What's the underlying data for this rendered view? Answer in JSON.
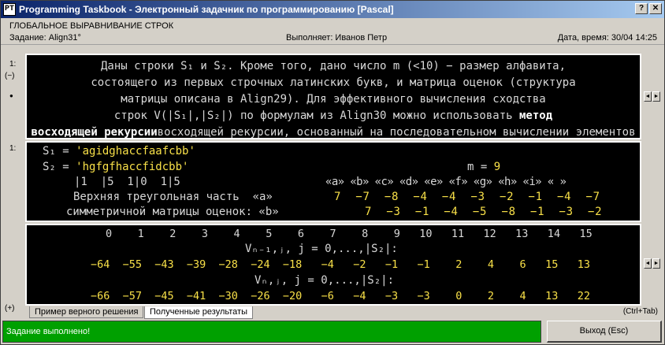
{
  "window": {
    "title": "Programming Taskbook - Электронный задачник по программированию [Pascal]",
    "app_icon": "PT",
    "help_btn": "?",
    "close_btn": "✕"
  },
  "header": {
    "section_title": "ГЛОБАЛЬНОЕ ВЫРАВНИВАНИЕ СТРОК",
    "task": "Задание: Align31°",
    "performer": "Выполняет: Иванов Петр",
    "datetime": "Дата, время: 30/04 14:25"
  },
  "task_panel": {
    "label_top": "1:",
    "label_collapse": "(−)",
    "bullet": "●",
    "lines": [
      "Даны строки S₁ и S₂. Кроме того, дано число m (<10) − размер алфавита,",
      "состоящего из первых строчных латинских букв, и матрица оценок (структура",
      "матрицы описана в Align29). Для эффективного вычисления сходства",
      "строк V(|S₁|,|S₂|) по формулам из Align30 можно использовать ",
      "восходящей рекурсии, основанный на последовательном вычислении элементов"
    ],
    "bold_1": "метод",
    "bold_2": "восходящей рекурсии"
  },
  "data_panel": {
    "label": "1:",
    "s1_label": "S₁ = ",
    "s1_value": "'agidghaccfaafcbb'",
    "s2_label": "S₂ = ",
    "s2_value": "'hgfgfhaccfidcbb'",
    "m_label": "m = ",
    "m_value": "9",
    "row3_left": "|1  |5  1|0  1|5",
    "alphabet_header": "«a» «b» «c» «d» «e» «f» «g» «h» «i» « »",
    "row4_label": "Верхняя треугольная часть  «a»",
    "row4_values": "7  −7  −8  −4  −4  −3  −2  −1  −4  −7",
    "row5_label": "симметричной матрицы оценок: «b»",
    "row5_values": "7  −3  −1  −4  −5  −8  −1  −3  −2"
  },
  "result_panel": {
    "indices": "0    1    2    3    4    5    6    7    8    9   10   11   12   13   14   15",
    "caption1": "Vₙ₋₁,ⱼ, j = 0,...,|S₂|:",
    "values1": "−64  −55  −43  −39  −28  −24  −18   −4   −2   −1   −1    2    4    6   15   13",
    "caption2": "Vₙ,ⱼ, j = 0,...,|S₂|:",
    "values2": "−66  −57  −45  −41  −30  −26  −20   −6   −4   −3   −3    0    2    4   13   22"
  },
  "bottom": {
    "expand_label": "(+)",
    "tab1": "Пример верного решения",
    "tab2": "Полученные результаты",
    "ctrl_tab": "(Ctrl+Tab)"
  },
  "status": {
    "message": "Задание выполнено!",
    "exit_button": "Выход (Esc)",
    "status_color": "#00a000"
  },
  "icons": {
    "scroll_left": "◄",
    "scroll_right": "►"
  }
}
